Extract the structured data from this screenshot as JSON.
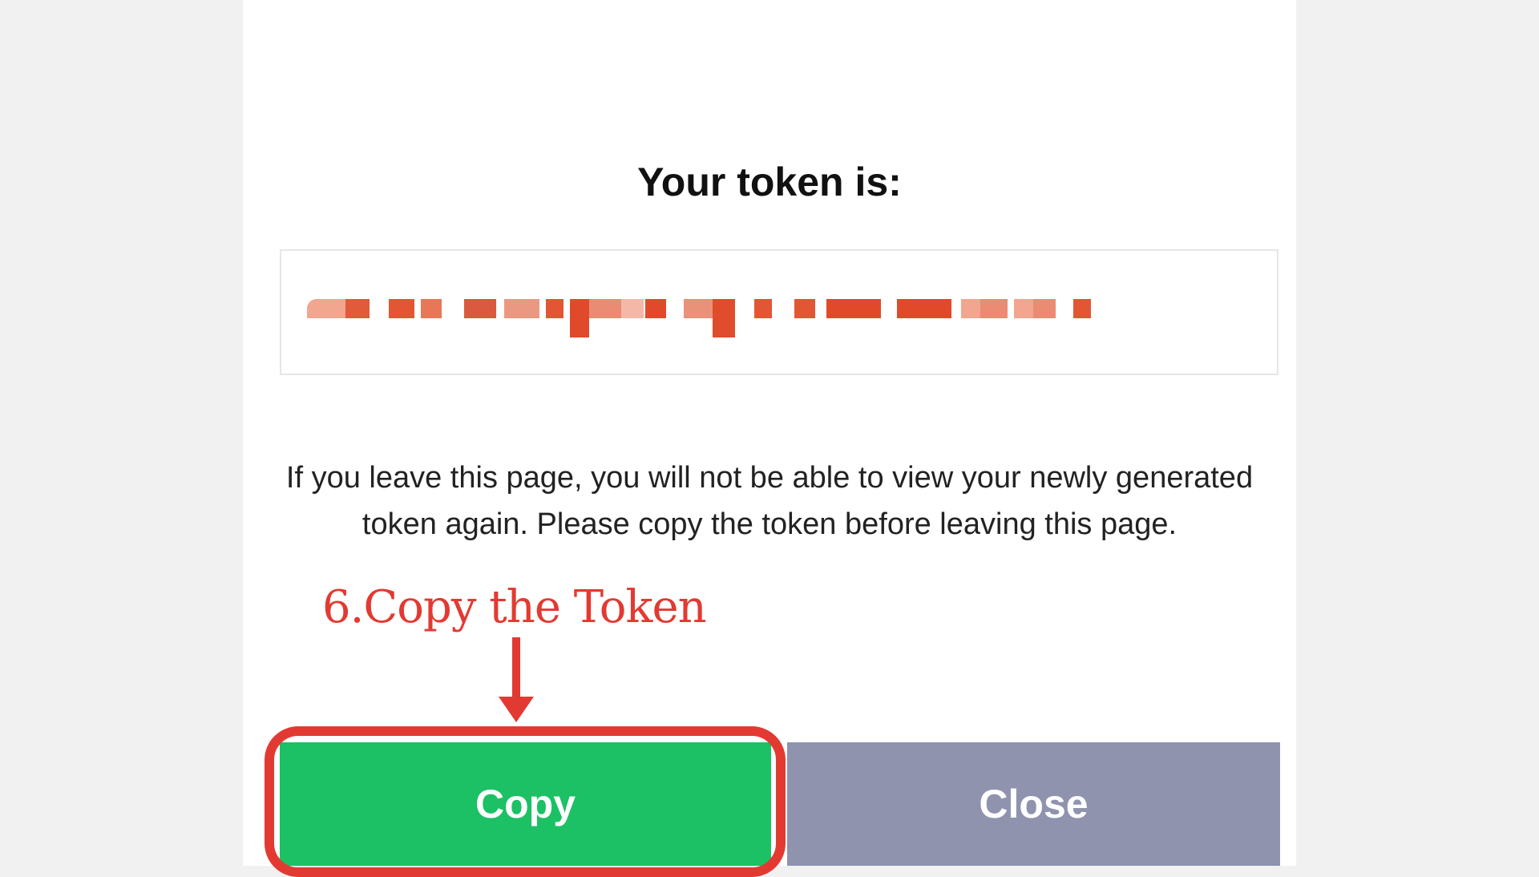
{
  "dialog": {
    "title": "Your token is:",
    "token_field": {
      "value_visible": "redacted (pixelated)"
    },
    "warning_text": "If you leave this page, you will not be able to view your newly generated token again. Please copy the token before leaving this page.",
    "buttons": {
      "copy_label": "Copy",
      "close_label": "Close"
    }
  },
  "annotation": {
    "step_label": "6.Copy the Token"
  },
  "colors": {
    "page_background": "#f1f1f1",
    "panel_background": "#ffffff",
    "copy_button": "#1bc164",
    "close_button": "#8f93ae",
    "annotation_red": "#e23a32",
    "token_mosaic": "#e0502e"
  },
  "icons": {
    "arrow": "down-arrow-icon"
  }
}
